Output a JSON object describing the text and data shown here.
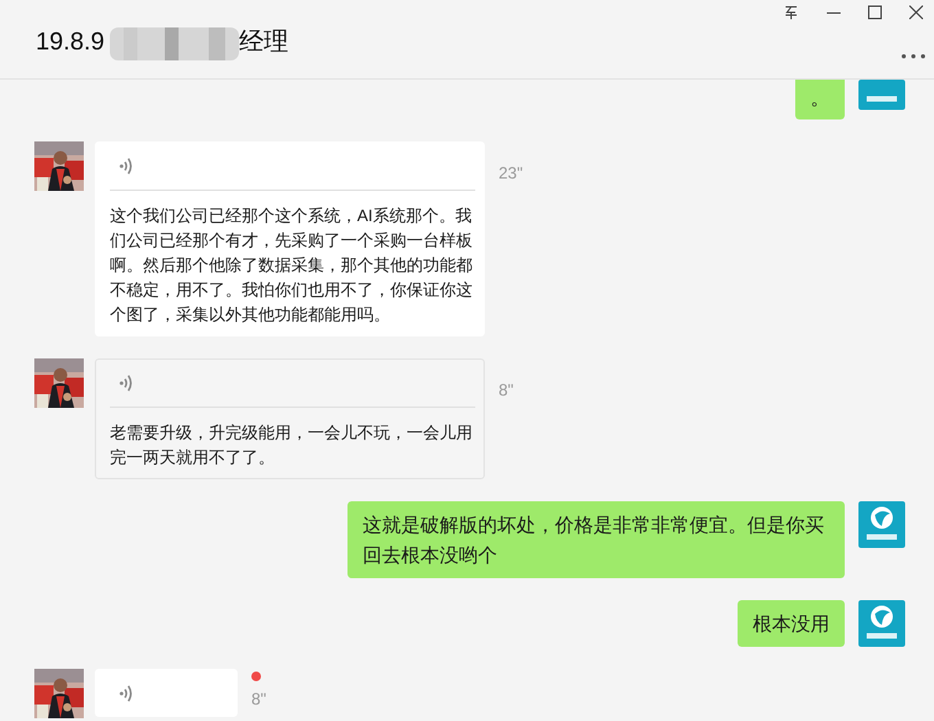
{
  "window": {
    "title_start": "19.8.9",
    "title_end": "经理"
  },
  "messages": [
    {
      "kind": "sent_text",
      "text": "。"
    },
    {
      "kind": "received_voice",
      "duration": "23\"",
      "transcript": "这个我们公司已经那个这个系统，AI系统那个。我们公司已经那个有才，先采购了一个采购一台样板啊。然后那个他除了数据采集，那个其他的功能都不稳定，用不了。我怕你们也用不了，你保证你这个图了，采集以外其他功能都能用吗。",
      "highlighted": false,
      "unread": false
    },
    {
      "kind": "received_voice",
      "duration": "8\"",
      "transcript": "老需要升级，升完级能用，一会儿不玩，一会儿用完一两天就用不了了。",
      "highlighted": true,
      "unread": false
    },
    {
      "kind": "sent_text",
      "text": "这就是破解版的坏处，价格是非常非常便宜。但是你买回去根本没哟个"
    },
    {
      "kind": "sent_text",
      "text": "根本没用"
    },
    {
      "kind": "received_voice",
      "duration": "8\"",
      "highlighted": false,
      "unread": true
    }
  ]
}
